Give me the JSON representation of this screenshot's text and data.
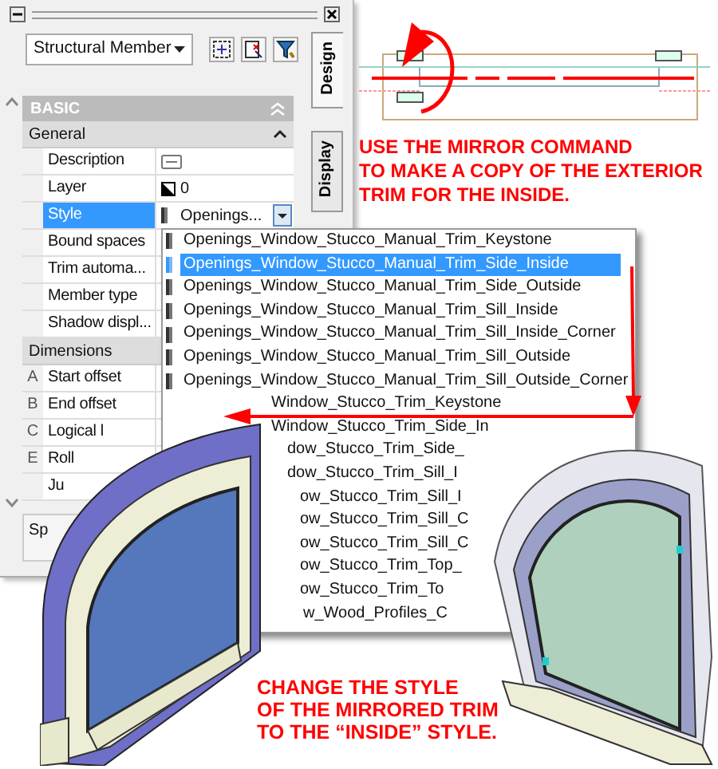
{
  "palette": {
    "object_type": "Structural Member",
    "tabs": [
      {
        "label": "Design",
        "selected": true
      },
      {
        "label": "Display",
        "selected": false
      }
    ],
    "category": "BASIC",
    "sections": [
      {
        "title": "General",
        "properties": [
          {
            "label": "Description",
            "kind": "button",
            "selected": false
          },
          {
            "label": "Layer",
            "kind": "layer",
            "value": "0",
            "selected": false
          },
          {
            "label": "Style",
            "kind": "style",
            "value": "Openings...",
            "selected": true
          },
          {
            "label": "Bound spaces",
            "selected": false
          },
          {
            "label": "Trim automa...",
            "selected": false
          },
          {
            "label": "Member type",
            "selected": false
          },
          {
            "label": "Shadow displ...",
            "selected": false
          }
        ]
      },
      {
        "title": "Dimensions",
        "properties": [
          {
            "letter": "A",
            "label": "Start offset",
            "selected": false
          },
          {
            "letter": "B",
            "label": "End offset",
            "selected": false
          },
          {
            "letter": "C",
            "label": "Logical l",
            "selected": false
          },
          {
            "letter": "E",
            "label": "Roll",
            "selected": false
          },
          {
            "label": "Ju",
            "selected": false
          }
        ]
      }
    ],
    "footer": "Sp"
  },
  "style_list": {
    "items": [
      {
        "label": "Openings_Window_Stucco_Manual_Trim_Keystone",
        "selected": false
      },
      {
        "label": "Openings_Window_Stucco_Manual_Trim_Side_Inside",
        "selected": true
      },
      {
        "label": "Openings_Window_Stucco_Manual_Trim_Side_Outside",
        "selected": false
      },
      {
        "label": "Openings_Window_Stucco_Manual_Trim_Sill_Inside",
        "selected": false
      },
      {
        "label": "Openings_Window_Stucco_Manual_Trim_Sill_Inside_Corner",
        "selected": false
      },
      {
        "label": "Openings_Window_Stucco_Manual_Trim_Sill_Outside",
        "selected": false
      },
      {
        "label": "Openings_Window_Stucco_Manual_Trim_Sill_Outside_Corner",
        "selected": false
      },
      {
        "label": "Window_Stucco_Trim_Keystone",
        "selected": false
      },
      {
        "label": "Window_Stucco_Trim_Side_In",
        "selected": false
      },
      {
        "label": "dow_Stucco_Trim_Side_",
        "selected": false
      },
      {
        "label": "dow_Stucco_Trim_Sill_I",
        "selected": false
      },
      {
        "label": "ow_Stucco_Trim_Sill_I",
        "selected": false
      },
      {
        "label": "ow_Stucco_Trim_Sill_C",
        "selected": false
      },
      {
        "label": "ow_Stucco_Trim_Sill_C",
        "selected": false
      },
      {
        "label": "ow_Stucco_Trim_Top_",
        "selected": false
      },
      {
        "label": "ow_Stucco_Trim_To",
        "selected": false
      },
      {
        "label": "w_Wood_Profiles_C",
        "selected": false
      }
    ]
  },
  "annotations": [
    {
      "lines": [
        "USE THE MIRROR COMMAND",
        "TO MAKE A COPY OF THE EXTERIOR",
        "TRIM FOR THE INSIDE."
      ]
    },
    {
      "lines": [
        "CHANGE THE STYLE",
        "OF THE MIRRORED TRIM",
        "TO THE “INSIDE” STYLE."
      ]
    }
  ]
}
